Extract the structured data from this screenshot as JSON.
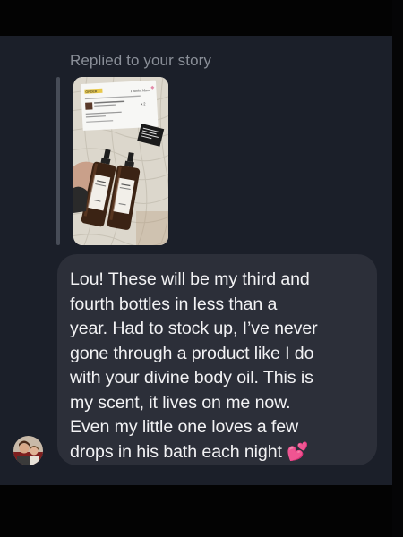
{
  "thread": {
    "reply_header": "Replied to your story",
    "story": {
      "card_tag": "ORDER",
      "card_heading": "Thanks Mum",
      "card_qty": "x 2",
      "note": "Thank you for the gift!",
      "label_brand": "BODY OIL",
      "label_sub": "divine"
    },
    "message": {
      "text": "Lou! These will be my third and\nfourth bottles in less than a\nyear. Had to stock up, I’ve never\ngone through a product like I do\nwith your divine body oil. This is\nmy scent, it lives on me now.\nEven my little one loves a few\ndrops in his bath each night 💕"
    }
  },
  "colors": {
    "background": "#1b1f29",
    "bubble": "#2c2f39",
    "text": "#f2f2f4",
    "muted": "#8a8f98"
  }
}
